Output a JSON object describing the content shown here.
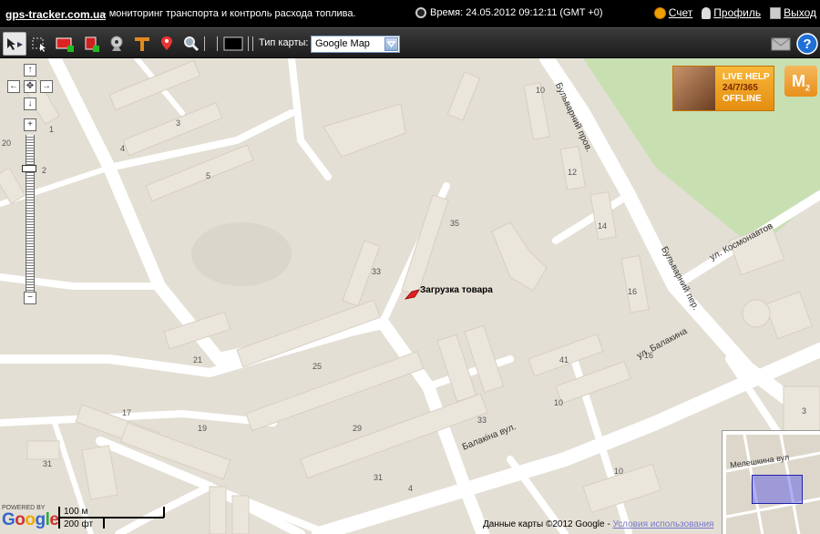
{
  "topbar": {
    "site": "gps-tracker.com.ua",
    "tagline": "- мониторинг транспорта и контроль расхода топлива.",
    "time": "Время: 24.05.2012 09:12:11 (GMT +0)",
    "links": {
      "account": "Счет",
      "profile": "Профиль",
      "logout": "Выход"
    }
  },
  "toolbar": {
    "map_type_label": "Тип карты:",
    "map_type_value": "Google Map"
  },
  "map": {
    "marker_label": "Загрузка товара",
    "streets": {
      "bulvarny_prov": "Бульварний пров.",
      "bulvarny_per": "Бульварний пер.",
      "kosmonavtov": "ул. Космонавтов",
      "balakina": "ул. Балакина",
      "balakina_vul": "Балакіна вул."
    },
    "building_numbers": [
      "3",
      "5",
      "4",
      "2",
      "20",
      "1",
      "10",
      "12",
      "14",
      "35",
      "33",
      "16",
      "21",
      "25",
      "41",
      "10",
      "33",
      "17",
      "19",
      "29",
      "31",
      "31",
      "10",
      "4",
      "16",
      "3"
    ],
    "live_help": {
      "line1": "LIVE HELP",
      "line2": "24/7/365",
      "line3": "OFFLINE"
    },
    "m2_badge": "M",
    "overview_label": "Мелешкина вул",
    "scale": {
      "metric": "100 м",
      "imperial": "200 фт"
    },
    "powered_by": "POWERED BY",
    "logo": "Google",
    "copyright": "Данные карты ©2012 Google -",
    "terms": "Условия использования"
  }
}
